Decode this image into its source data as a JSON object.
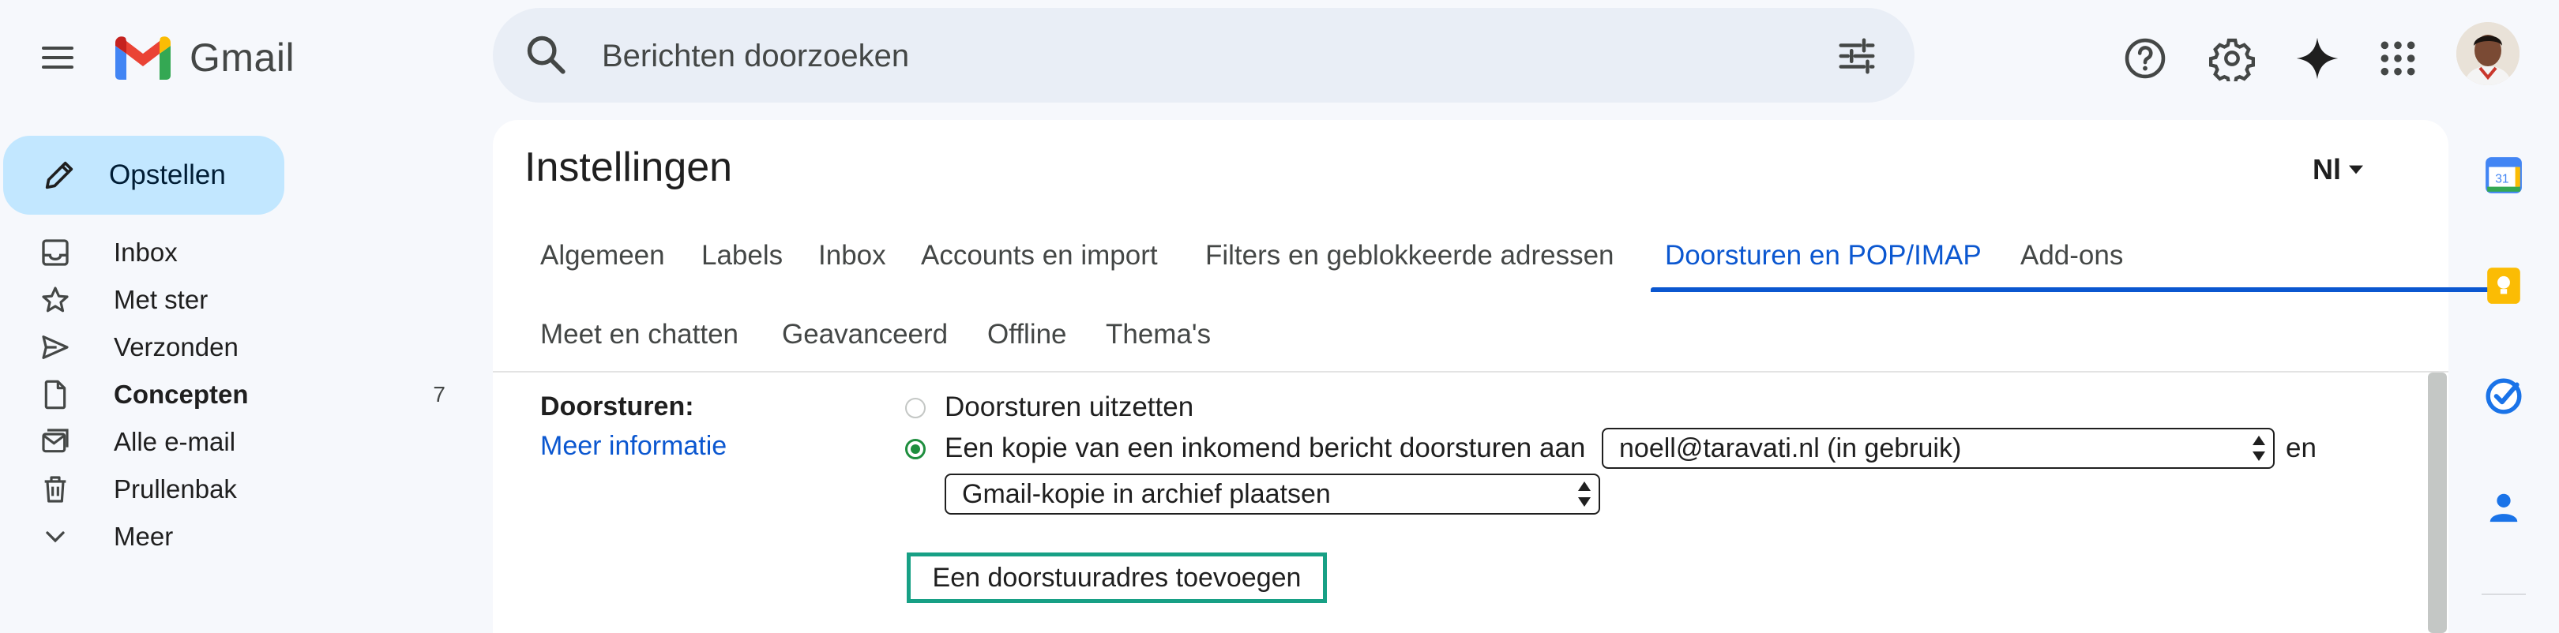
{
  "app": {
    "name": "Gmail"
  },
  "search": {
    "placeholder": "Berichten doorzoeken"
  },
  "header": {
    "icons": [
      "help-icon",
      "settings-icon",
      "gemini-icon",
      "apps-grid-icon"
    ]
  },
  "sidebar": {
    "compose_label": "Opstellen",
    "items": [
      {
        "label": "Inbox",
        "icon": "inbox-icon",
        "count": ""
      },
      {
        "label": "Met ster",
        "icon": "star-icon",
        "count": ""
      },
      {
        "label": "Verzonden",
        "icon": "send-icon",
        "count": ""
      },
      {
        "label": "Concepten",
        "icon": "draft-icon",
        "count": "7"
      },
      {
        "label": "Alle e-mail",
        "icon": "all-mail-icon",
        "count": ""
      },
      {
        "label": "Prullenbak",
        "icon": "trash-icon",
        "count": ""
      },
      {
        "label": "Meer",
        "icon": "chevron-down-icon",
        "count": ""
      }
    ]
  },
  "settings": {
    "title": "Instellingen",
    "input_tool": "Nl",
    "tabs_row1": [
      "Algemeen",
      "Labels",
      "Inbox",
      "Accounts en import",
      "Filters en geblokkeerde adressen",
      "Doorsturen en POP/IMAP",
      "Add-ons"
    ],
    "tabs_row2": [
      "Meet en chatten",
      "Geavanceerd",
      "Offline",
      "Thema's"
    ],
    "active_tab": "Doorsturen en POP/IMAP",
    "forwarding": {
      "heading": "Doorsturen:",
      "more_info": "Meer informatie",
      "option_off": "Doorsturen uitzetten",
      "option_on": "Een kopie van een inkomend bericht doorsturen aan",
      "address_value": "noell@taravati.nl (in gebruik)",
      "and_label": "en",
      "action_value": "Gmail-kopie in archief plaatsen",
      "add_address_button": "Een doorstuuradres toevoegen"
    }
  },
  "side_panel": {
    "apps": [
      "calendar-icon",
      "keep-icon",
      "tasks-icon",
      "contacts-icon"
    ],
    "calendar_day": "31"
  },
  "colors": {
    "accent": "#0b57d0",
    "compose_bg": "#c2e7ff",
    "radio_selected": "#1e8e3e",
    "focus_outline": "#17a085"
  }
}
